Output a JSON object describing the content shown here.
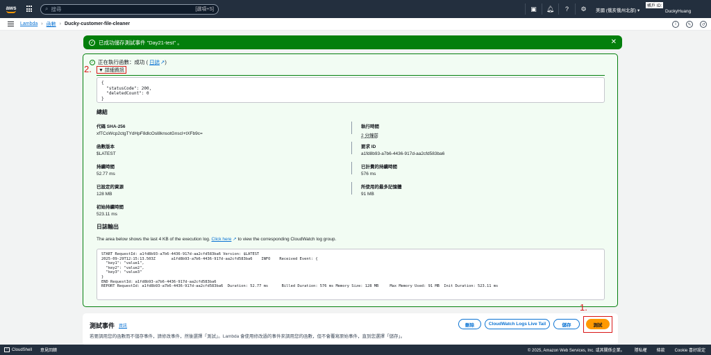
{
  "topnav": {
    "logo": "aws",
    "search_placeholder": "搜尋",
    "search_shortcut": "[選項+S]",
    "region": "美國 (俄亥俄州北部)",
    "account_label": "帳戶 ID:",
    "user": "DuckyHuang"
  },
  "breadcrumb": {
    "lambda": "Lambda",
    "functions": "函數",
    "current": "Ducky-customer-file-cleaner"
  },
  "flash": {
    "message": "已成功儲存測試事件 \"Day21-test\" 。"
  },
  "result": {
    "status_text": "正在執行函數：成功 (",
    "logs_link": "日誌",
    "status_close": ")",
    "details_label": "▼ 詳細資訊",
    "annotation_2": "2.",
    "json_output": "{\n  \"statusCode\": 200,\n  \"deletedCount\": 0\n}",
    "summary_title": "總結",
    "summary": {
      "code_sha_label": "代碼 SHA-256",
      "code_sha_value": "xfTCoWcp2ctgTYdHpF8dlcOsl8knsotGnscI+tXFb9c=",
      "exec_time_label": "執行時間",
      "exec_time_value": "2 分鐘前",
      "version_label": "函數版本",
      "version_value": "$LATEST",
      "request_id_label": "要求 ID",
      "request_id_value": "a1fd8b93-a7b6-4436-917d-aa2cfd583ba6",
      "duration_label": "持續時間",
      "duration_value": "52.77 ms",
      "billed_label": "已計費的持續時間",
      "billed_value": "576 ms",
      "resources_label": "已設定的資源",
      "resources_value": "128 MB",
      "max_mem_label": "所使用的最多記憶體",
      "max_mem_value": "91 MB",
      "init_label": "初始持續時間",
      "init_value": "523.11 ms"
    },
    "log_title": "日誌輸出",
    "log_desc_before": "The area below shows the last 4 KB of the execution log.",
    "log_desc_link": "Click here",
    "log_desc_after": "to view the corresponding CloudWatch log group.",
    "log_text": "START RequestId: a1fd8b93-a7b6-4436-917d-aa2cfd583ba6 Version: $LATEST\n2025-09-29T12:15:13.503Z       a1fd8b93-a7b6-4436-917d-aa2cfd583ba6    INFO    Received Event: {\n  \"key1\": \"value1\",\n  \"key2\": \"value2\",\n  \"key3\": \"value3\"\n}\nEND RequestId: a1fd8b93-a7b6-4436-917d-aa2cfd583ba6\nREPORT RequestId: a1fd8b93-a7b6-4436-917d-aa2cfd583ba6  Duration: 52.77 ms      Billed Duration: 576 ms Memory Size: 128 MB     Max Memory Used: 91 MB  Init Duration: 523.11 ms"
  },
  "test_panel": {
    "title": "測試事件",
    "info": "資訊",
    "desc": "若要調用您的函數而不儲存事件，請修改事件，然後選擇「測試」。Lambda 會使用修改過的事件來調用您的函數，但不會覆寫原始事件，直到您選擇「儲存」。",
    "delete": "刪除",
    "cloudwatch": "CloudWatch Logs Live Tail",
    "save": "儲存",
    "test": "測試",
    "annotation_1": "1."
  },
  "footer": {
    "cloudshell": "CloudShell",
    "feedback": "意見回饋",
    "copyright": "© 2025, Amazon Web Services, Inc. 或其關係企業。",
    "privacy": "隱私權",
    "terms": "條款",
    "cookie": "Cookie 喜好設定"
  },
  "colors": {
    "nav_bg": "#232f3e",
    "success": "#037f0c",
    "link": "#0972d3",
    "primary_button": "#ff9900",
    "annotation": "#d91515"
  }
}
